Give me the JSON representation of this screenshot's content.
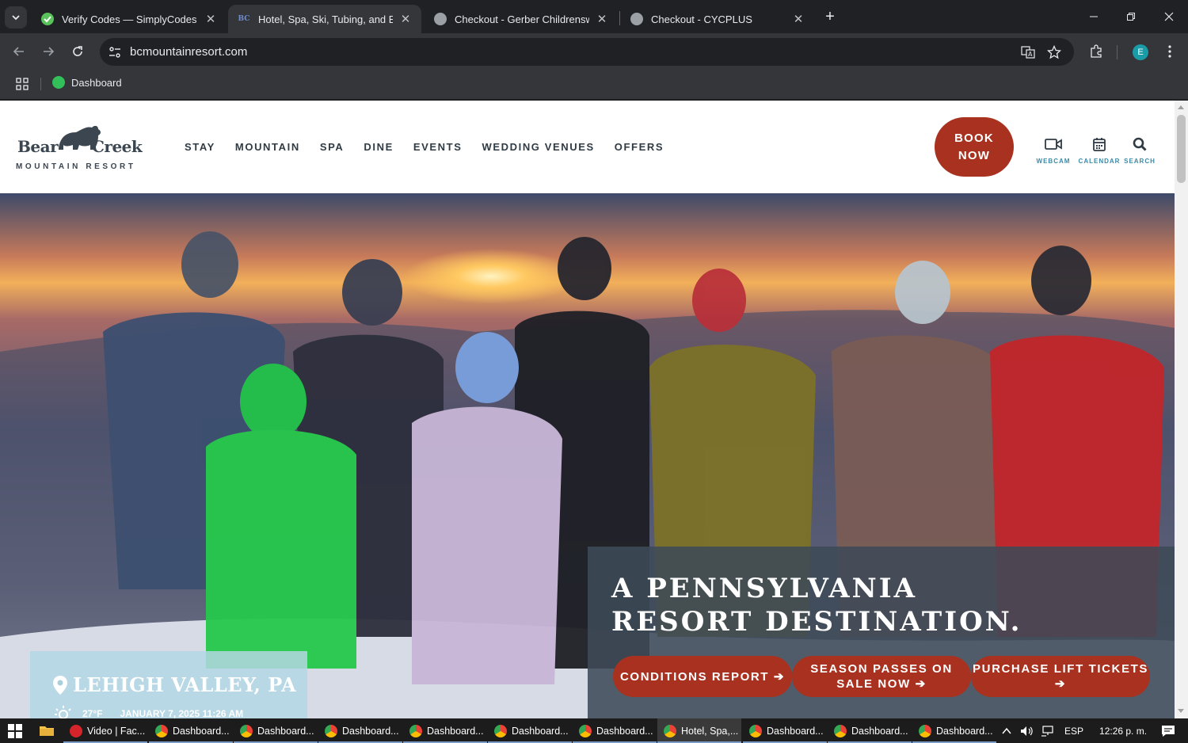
{
  "browser": {
    "tabs": [
      {
        "title": "Verify Codes — SimplyCodes",
        "favicon": "simplycodes-icon",
        "active": false
      },
      {
        "title": "Hotel, Spa, Ski, Tubing, and Eve",
        "favicon": "bc-icon",
        "active": true
      },
      {
        "title": "Checkout - Gerber Childrenswe",
        "favicon": "globe-icon",
        "active": false
      },
      {
        "title": "Checkout - CYCPLUS",
        "favicon": "globe-icon",
        "active": false
      }
    ],
    "bc_favicon_text": "BC",
    "url": "bcmountainresort.com",
    "profile_initial": "E",
    "bookmark": {
      "label": "Dashboard"
    }
  },
  "site": {
    "logo": {
      "word_left": "Bear",
      "word_right": "Creek",
      "subtitle": "MOUNTAIN RESORT"
    },
    "nav": [
      "STAY",
      "MOUNTAIN",
      "SPA",
      "DINE",
      "EVENTS",
      "WEDDING VENUES",
      "OFFERS"
    ],
    "book_line1": "BOOK",
    "book_line2": "NOW",
    "utilities": [
      {
        "label": "WEBCAM",
        "icon": "video-camera-icon"
      },
      {
        "label": "CALENDAR",
        "icon": "calendar-icon"
      },
      {
        "label": "SEARCH",
        "icon": "search-icon"
      }
    ],
    "hero": {
      "headline": "A PENNSYLVANIA RESORT DESTINATION.",
      "ctas": [
        "CONDITIONS REPORT",
        "SEASON PASSES ON SALE NOW",
        "PURCHASE LIFT TICKETS"
      ]
    },
    "weather": {
      "location": "LEHIGH VALLEY, PA",
      "temperature": "27°F",
      "datetime": "JANUARY 7, 2025 11:26 AM"
    },
    "colors": {
      "accent": "#a8321f",
      "text": "#2f3b45",
      "link": "#3b8aa5"
    }
  },
  "taskbar": {
    "items": [
      {
        "label": "Video | Fac...",
        "icon": "opera-icon"
      },
      {
        "label": "Dashboard...",
        "icon": "chrome-icon"
      },
      {
        "label": "Dashboard...",
        "icon": "chrome-icon"
      },
      {
        "label": "Dashboard...",
        "icon": "chrome-icon"
      },
      {
        "label": "Dashboard...",
        "icon": "chrome-icon"
      },
      {
        "label": "Dashboard...",
        "icon": "chrome-icon"
      },
      {
        "label": "Dashboard...",
        "icon": "chrome-icon"
      },
      {
        "label": "Hotel, Spa,...",
        "icon": "chrome-icon"
      },
      {
        "label": "Dashboard...",
        "icon": "chrome-icon"
      },
      {
        "label": "Dashboard...",
        "icon": "chrome-icon"
      },
      {
        "label": "Dashboard...",
        "icon": "chrome-icon"
      }
    ],
    "language": "ESP",
    "clock": "12:26 p. m."
  }
}
